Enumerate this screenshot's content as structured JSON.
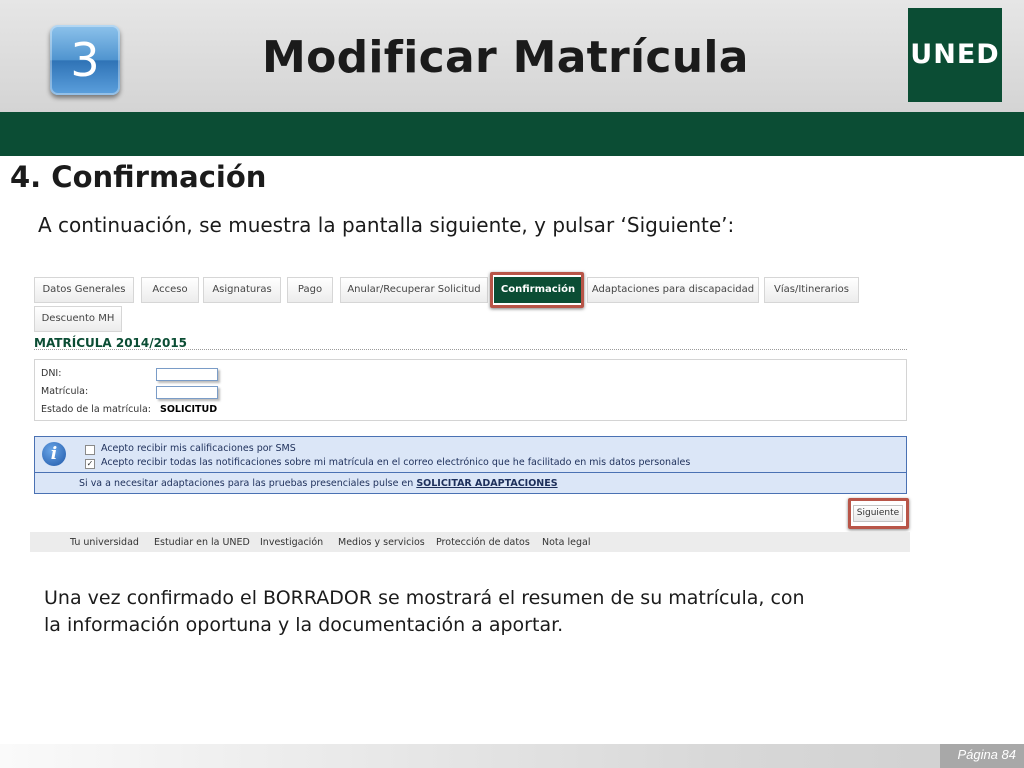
{
  "header": {
    "step_number": "3",
    "title": "Modificar Matrícula",
    "logo_text": "UNED"
  },
  "section": {
    "title": "4.  Confirmación",
    "intro": "A continuación, se muestra la pantalla siguiente, y pulsar ‘Siguiente’:"
  },
  "screenshot": {
    "tabs": [
      {
        "label": "Datos Generales",
        "active": false
      },
      {
        "label": "Acceso",
        "active": false
      },
      {
        "label": "Asignaturas",
        "active": false
      },
      {
        "label": "Pago",
        "active": false
      },
      {
        "label": "Anular/Recuperar Solicitud",
        "active": false
      },
      {
        "label": "Confirmación",
        "active": true
      },
      {
        "label": "Adaptaciones para discapacidad",
        "active": false
      },
      {
        "label": "Vías/Itinerarios",
        "active": false
      },
      {
        "label": "Descuento MH",
        "active": false
      }
    ],
    "matricula_title": "MATRÍCULA 2014/2015",
    "form": {
      "dni_label": "DNI:",
      "dni_value": "",
      "matricula_label": "Matrícula:",
      "matricula_value": "",
      "estado_label": "Estado de la matrícula:",
      "estado_value": "SOLICITUD"
    },
    "info": {
      "icon": "info-icon",
      "sms_label": "Acepto recibir mis calificaciones por SMS",
      "sms_checked": false,
      "email_label": "Acepto recibir todas las notificaciones sobre mi matrícula en el correo electrónico que he facilitado en mis datos personales",
      "email_checked": true,
      "adapt_text": "Si va a necesitar adaptaciones para las pruebas presenciales pulse en",
      "adapt_link": "SOLICITAR ADAPTACIONES"
    },
    "siguiente_label": "Siguiente",
    "footer_nav": [
      "Tu universidad",
      "Estudiar en la UNED",
      "Investigación",
      "Medios y servicios",
      "Protección de datos",
      "Nota legal"
    ]
  },
  "outro": "Una vez confirmado el BORRADOR se mostrará el resumen de su matrícula, con la información oportuna y la documentación a aportar.",
  "page": {
    "label": "Página 84"
  },
  "colors": {
    "brand_green": "#0b4d34",
    "highlight_red": "#b85548",
    "info_blue": "#dbe6f7"
  }
}
